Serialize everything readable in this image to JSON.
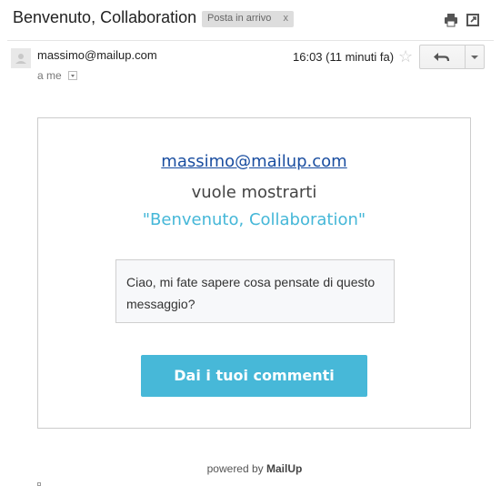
{
  "header": {
    "subject": "Benvenuto, Collaboration",
    "label_chip": "Posta in arrivo",
    "label_remove": "x",
    "print_icon": "print-icon",
    "popout_icon": "open-in-new-window-icon"
  },
  "message_meta": {
    "avatar_icon": "default-avatar-icon",
    "sender": "massimo@mailup.com",
    "recipient": "a me",
    "timestamp": "16:03 (11 minuti fa)",
    "star_icon": "star-outline-icon",
    "reply_icon": "reply-arrow-icon",
    "more_icon": "chevron-down-icon"
  },
  "card": {
    "sender_link": "massimo@mailup.com",
    "intro": "vuole mostrarti",
    "title": "\"Benvenuto, Collaboration\"",
    "message": "Ciao, mi fate sapere cosa pensate di questo messaggio?",
    "cta_label": "Dai i tuoi commenti",
    "accent_color": "#47b8d8",
    "link_color": "#1a4ea0"
  },
  "footer": {
    "powered_prefix": "powered by",
    "brand": "MailUp"
  }
}
